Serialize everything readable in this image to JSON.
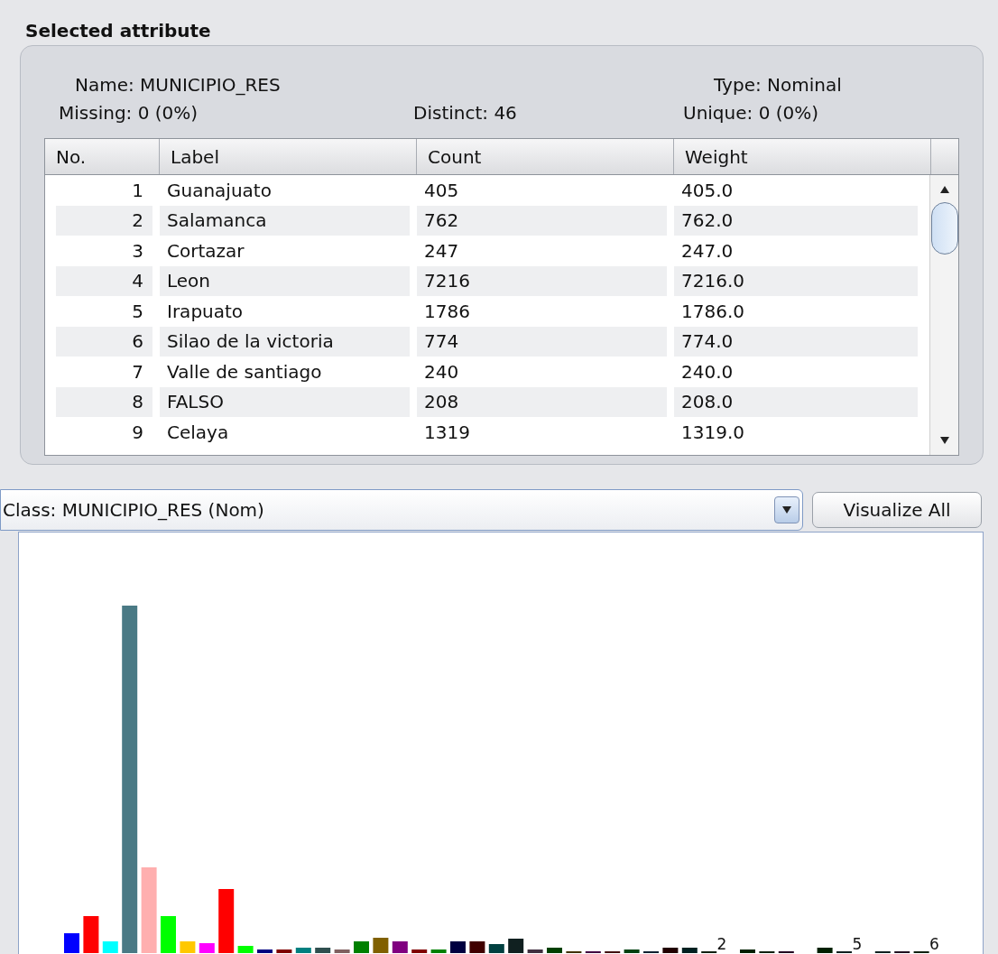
{
  "section_title": "Selected attribute",
  "attribute": {
    "name": "Name: MUNICIPIO_RES",
    "type": "Type: Nominal",
    "missing": "Missing: 0 (0%)",
    "distinct": "Distinct: 46",
    "unique": "Unique: 0 (0%)"
  },
  "table": {
    "columns": [
      "No.",
      "Label",
      "Count",
      "Weight"
    ],
    "rows": [
      {
        "no": "1",
        "label": "Guanajuato",
        "count": "405",
        "weight": "405.0"
      },
      {
        "no": "2",
        "label": "Salamanca",
        "count": "762",
        "weight": "762.0"
      },
      {
        "no": "3",
        "label": "Cortazar",
        "count": "247",
        "weight": "247.0"
      },
      {
        "no": "4",
        "label": "Leon",
        "count": "7216",
        "weight": "7216.0"
      },
      {
        "no": "5",
        "label": "Irapuato",
        "count": "1786",
        "weight": "1786.0"
      },
      {
        "no": "6",
        "label": "Silao de la victoria",
        "count": "774",
        "weight": "774.0"
      },
      {
        "no": "7",
        "label": "Valle de santiago",
        "count": "240",
        "weight": "240.0"
      },
      {
        "no": "8",
        "label": "FALSO",
        "count": "208",
        "weight": "208.0"
      },
      {
        "no": "9",
        "label": "Celaya",
        "count": "1319",
        "weight": "1319.0"
      }
    ]
  },
  "class_selector": {
    "value": "Class: MUNICIPIO_RES (Nom)"
  },
  "visualize_button": "Visualize All",
  "histogram": {
    "bar_labels": [
      "2",
      "5",
      "6"
    ]
  }
}
